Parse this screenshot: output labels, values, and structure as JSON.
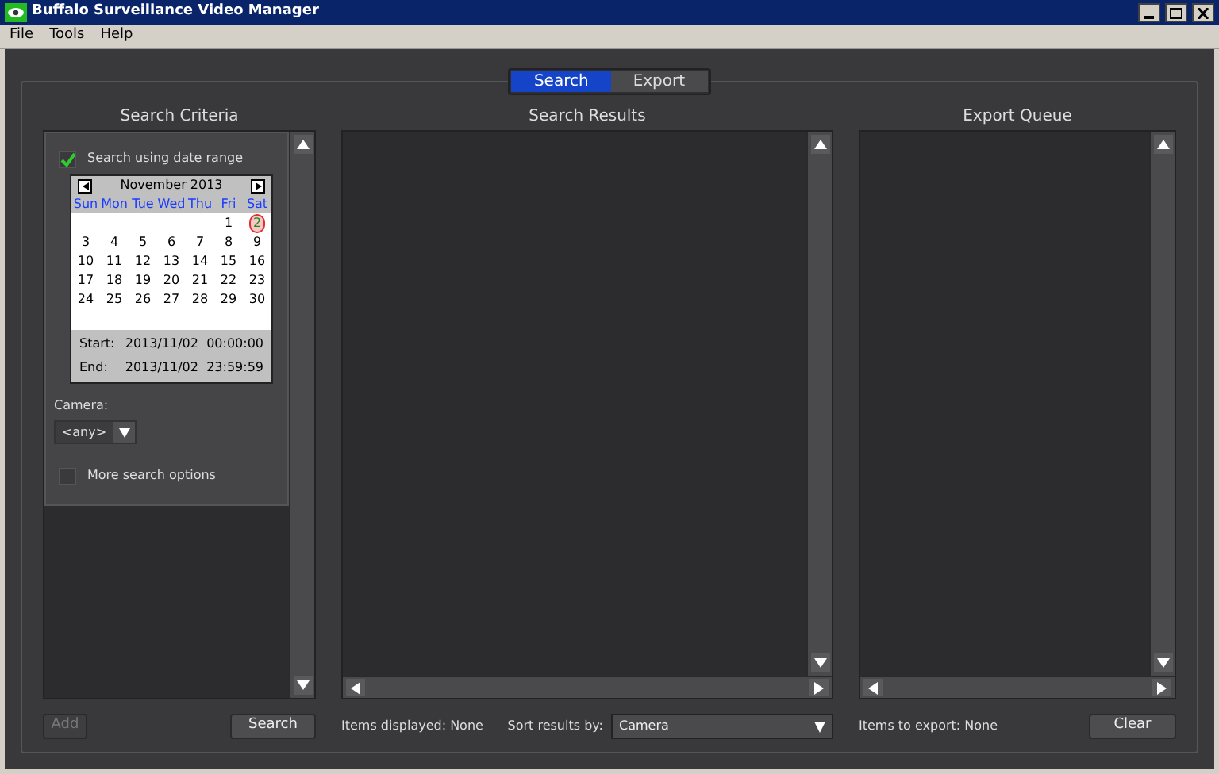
{
  "window": {
    "title": "Buffalo Surveillance Video Manager"
  },
  "menu": [
    "File",
    "Tools",
    "Help"
  ],
  "tabs": [
    {
      "label": "Search",
      "selected": true
    },
    {
      "label": "Export",
      "selected": false
    }
  ],
  "criteria": {
    "heading": "Search Criteria",
    "date_range": {
      "label": "Search using date range",
      "checked": true
    },
    "calendar": {
      "month": "November 2013",
      "weekdays": [
        "Sun",
        "Mon",
        "Tue",
        "Wed",
        "Thu",
        "Fri",
        "Sat"
      ],
      "weeks": [
        [
          {
            "day": "1",
            "selected": false
          },
          {
            "day": "2",
            "selected": true
          }
        ],
        [
          {
            "day": "3",
            "selected": false
          },
          {
            "day": "4",
            "selected": false
          },
          {
            "day": "5",
            "selected": false
          },
          {
            "day": "6",
            "selected": false
          },
          {
            "day": "7",
            "selected": false
          },
          {
            "day": "8",
            "selected": false
          },
          {
            "day": "9",
            "selected": false
          }
        ],
        [
          {
            "day": "10",
            "selected": false
          },
          {
            "day": "11",
            "selected": false
          },
          {
            "day": "12",
            "selected": false
          },
          {
            "day": "13",
            "selected": false
          },
          {
            "day": "14",
            "selected": false
          },
          {
            "day": "15",
            "selected": false
          },
          {
            "day": "16",
            "selected": false
          }
        ],
        [
          {
            "day": "17",
            "selected": false
          },
          {
            "day": "18",
            "selected": false
          },
          {
            "day": "19",
            "selected": false
          },
          {
            "day": "20",
            "selected": false
          },
          {
            "day": "21",
            "selected": false
          },
          {
            "day": "22",
            "selected": false
          },
          {
            "day": "23",
            "selected": false
          }
        ],
        [
          {
            "day": "24",
            "selected": false
          },
          {
            "day": "25",
            "selected": false
          },
          {
            "day": "26",
            "selected": false
          },
          {
            "day": "27",
            "selected": false
          },
          {
            "day": "28",
            "selected": false
          },
          {
            "day": "29",
            "selected": false
          },
          {
            "day": "30",
            "selected": false
          }
        ]
      ],
      "start_label": "Start:",
      "start": "2013/11/02  00:00:00",
      "end_label": "End:",
      "end": "2013/11/02  23:59:59"
    },
    "camera_label": "Camera:",
    "camera": "<any>",
    "more_options": {
      "label": "More search options",
      "checked": false
    },
    "add_button": {
      "label": "Add",
      "disabled": true
    },
    "search_button": {
      "label": "Search",
      "disabled": false
    }
  },
  "results": {
    "heading": "Search Results",
    "status": "Items displayed: None",
    "sort_label": "Sort results by:",
    "sort_value": "Camera"
  },
  "queue": {
    "heading": "Export Queue",
    "status": "Items to export: None",
    "clear_button": {
      "label": "Clear",
      "disabled": false
    }
  }
}
